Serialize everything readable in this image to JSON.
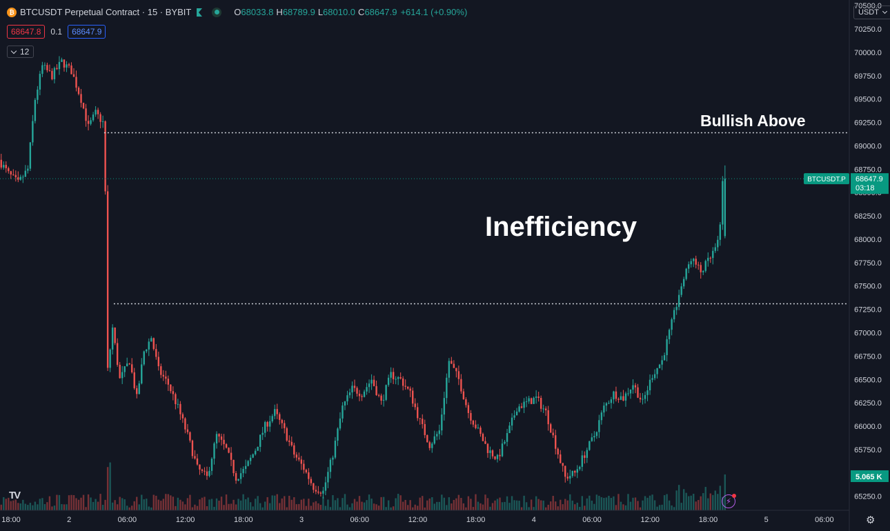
{
  "header": {
    "coin_glyph": "₿",
    "symbol": "BTCUSDT Perpetual Contract · 15 · BYBIT",
    "ohlc": [
      {
        "k": "O",
        "v": "68033.8"
      },
      {
        "k": "H",
        "v": "68789.9"
      },
      {
        "k": "L",
        "v": "68010.0"
      },
      {
        "k": "C",
        "v": "68647.9"
      }
    ],
    "change": "+614.1 (+0.90%)",
    "bid": "68647.8",
    "spread": "0.1",
    "ask": "68647.9",
    "indicators_count": "12",
    "currency": "USDT",
    "tv_logo": "TV",
    "gear_glyph": "⚙",
    "bolt_glyph": "⚡"
  },
  "annotations": {
    "bullish": "Bullish Above",
    "inefficiency": "Inefficiency"
  },
  "chart_data": {
    "type": "candlestick",
    "y_axis": {
      "ticks": [
        65250,
        65500,
        65750,
        66000,
        66250,
        66500,
        66750,
        67000,
        67250,
        67500,
        67750,
        68000,
        68250,
        68500,
        68750,
        69000,
        69250,
        69500,
        69750,
        70000,
        70250,
        70500
      ],
      "tick_labels": [
        "65250.0",
        "65500.0",
        "65750.0",
        "66000.0",
        "66250.0",
        "66500.0",
        "66750.0",
        "67000.0",
        "67250.0",
        "67500.0",
        "67750.0",
        "68000.0",
        "68250.0",
        "68500.0",
        "68750.0",
        "69000.0",
        "69250.0",
        "69500.0",
        "69750.0",
        "70000.0",
        "70250.0",
        "70500.0"
      ],
      "range": [
        65100,
        70560
      ]
    },
    "x_axis": {
      "labels": [
        {
          "t": 0,
          "label": "18:00"
        },
        {
          "t": 24,
          "label": "2"
        },
        {
          "t": 48,
          "label": "06:00"
        },
        {
          "t": 72,
          "label": "12:00"
        },
        {
          "t": 96,
          "label": "18:00"
        },
        {
          "t": 120,
          "label": "3"
        },
        {
          "t": 144,
          "label": "06:00"
        },
        {
          "t": 168,
          "label": "12:00"
        },
        {
          "t": 192,
          "label": "18:00"
        },
        {
          "t": 216,
          "label": "4"
        },
        {
          "t": 240,
          "label": "06:00"
        },
        {
          "t": 264,
          "label": "12:00"
        },
        {
          "t": 288,
          "label": "18:00"
        },
        {
          "t": 312,
          "label": "5"
        },
        {
          "t": 336,
          "label": "06:00"
        }
      ],
      "range": [
        0,
        350
      ]
    },
    "price_path": [
      [
        0,
        68850
      ],
      [
        4,
        68700
      ],
      [
        8,
        68600
      ],
      [
        12,
        68750
      ],
      [
        15,
        69500
      ],
      [
        18,
        69850
      ],
      [
        22,
        69750
      ],
      [
        26,
        69900
      ],
      [
        30,
        69800
      ],
      [
        34,
        69500
      ],
      [
        37,
        69200
      ],
      [
        40,
        69350
      ],
      [
        43,
        69250
      ],
      [
        44,
        68500
      ],
      [
        45,
        66600
      ],
      [
        47,
        67050
      ],
      [
        50,
        66500
      ],
      [
        54,
        66700
      ],
      [
        57,
        66300
      ],
      [
        60,
        66800
      ],
      [
        63,
        66950
      ],
      [
        66,
        66600
      ],
      [
        70,
        66450
      ],
      [
        74,
        66200
      ],
      [
        78,
        65900
      ],
      [
        82,
        65550
      ],
      [
        86,
        65450
      ],
      [
        90,
        65900
      ],
      [
        94,
        65750
      ],
      [
        98,
        65450
      ],
      [
        102,
        65550
      ],
      [
        106,
        65750
      ],
      [
        110,
        66000
      ],
      [
        114,
        66150
      ],
      [
        118,
        65950
      ],
      [
        122,
        65700
      ],
      [
        126,
        65550
      ],
      [
        130,
        65350
      ],
      [
        134,
        65300
      ],
      [
        138,
        65700
      ],
      [
        142,
        66200
      ],
      [
        146,
        66400
      ],
      [
        150,
        66350
      ],
      [
        154,
        66500
      ],
      [
        158,
        66250
      ],
      [
        162,
        66550
      ],
      [
        166,
        66500
      ],
      [
        170,
        66350
      ],
      [
        174,
        66050
      ],
      [
        178,
        65800
      ],
      [
        182,
        65950
      ],
      [
        186,
        66700
      ],
      [
        190,
        66500
      ],
      [
        194,
        66150
      ],
      [
        198,
        65950
      ],
      [
        202,
        65750
      ],
      [
        206,
        65650
      ],
      [
        210,
        65900
      ],
      [
        214,
        66200
      ],
      [
        218,
        66250
      ],
      [
        222,
        66300
      ],
      [
        226,
        66150
      ],
      [
        230,
        65800
      ],
      [
        234,
        65450
      ],
      [
        238,
        65500
      ],
      [
        242,
        65700
      ],
      [
        246,
        65900
      ],
      [
        250,
        66200
      ],
      [
        254,
        66350
      ],
      [
        258,
        66300
      ],
      [
        262,
        66450
      ],
      [
        266,
        66250
      ],
      [
        270,
        66550
      ],
      [
        274,
        66700
      ],
      [
        278,
        67100
      ],
      [
        282,
        67500
      ],
      [
        286,
        67800
      ],
      [
        290,
        67650
      ],
      [
        294,
        67800
      ],
      [
        297,
        67950
      ],
      [
        298,
        68150
      ],
      [
        299,
        68647.9
      ]
    ],
    "last_candle": {
      "t": 299,
      "o": 68033.8,
      "h": 68789.9,
      "l": 68010.0,
      "c": 68647.9
    },
    "levels": [
      {
        "name": "bullish-above-level",
        "price": 69140,
        "from_t": 43
      },
      {
        "name": "inefficiency-level",
        "price": 67310,
        "from_t": 47
      }
    ],
    "current_price": {
      "symbol": "BTCUSDT.P",
      "price": "68647.9",
      "countdown": "03:18",
      "value": 68647.9
    },
    "volume": {
      "label": "5.065 K"
    },
    "colors": {
      "up": "#26a69a",
      "down": "#ef5350",
      "background": "#131722",
      "axis_text": "#d1d4dc",
      "level": "#d1d4dc",
      "price_tag": "#089981"
    }
  }
}
